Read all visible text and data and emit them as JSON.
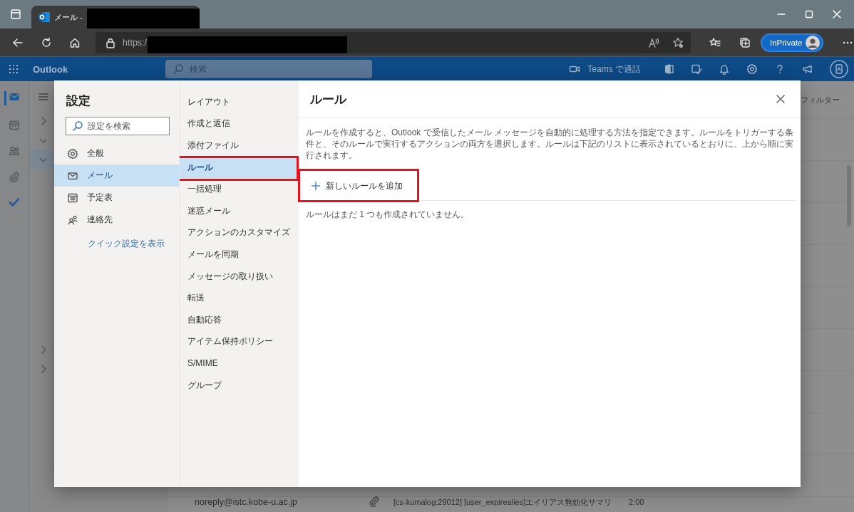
{
  "browser": {
    "tab_title": "メール -",
    "url": "https:/",
    "profile_label": "InPrivate"
  },
  "app": {
    "name": "Outlook",
    "search_placeholder": "検索",
    "teams_call": "Teams で通話"
  },
  "folders": [
    {
      "expanded": false,
      "selected": false
    },
    {
      "expanded": true,
      "selected": false
    },
    {
      "expanded": true,
      "selected": true
    }
  ],
  "folders_lower": [
    {
      "expanded": false,
      "selected": false
    },
    {
      "expanded": false,
      "selected": false
    }
  ],
  "mail_list": {
    "filter": "フィルター",
    "rows": [
      {
        "sender": "noreply@istc.kobe-u.ac.jp",
        "attachment": true,
        "subject": "[cs-kumalog:29012] [user_expirealies]エイリアス無効化サマリ",
        "time": "2:00"
      }
    ]
  },
  "settings": {
    "title": "設定",
    "search_placeholder": "設定を検索",
    "categories": [
      {
        "label": "全般",
        "selected": false
      },
      {
        "label": "メール",
        "selected": true
      },
      {
        "label": "予定表",
        "selected": false
      },
      {
        "label": "連絡先",
        "selected": false
      }
    ],
    "quick_link": "クイック設定を表示",
    "sub_items": [
      {
        "label": "レイアウト",
        "selected": false,
        "highlighted": false
      },
      {
        "label": "作成と返信",
        "selected": false,
        "highlighted": false
      },
      {
        "label": "添付ファイル",
        "selected": false,
        "highlighted": false
      },
      {
        "label": "ルール",
        "selected": true,
        "highlighted": true
      },
      {
        "label": "一括処理",
        "selected": false,
        "highlighted": false
      },
      {
        "label": "迷惑メール",
        "selected": false,
        "highlighted": false
      },
      {
        "label": "アクションのカスタマイズ",
        "selected": false,
        "highlighted": false
      },
      {
        "label": "メールを同期",
        "selected": false,
        "highlighted": false
      },
      {
        "label": "メッセージの取り扱い",
        "selected": false,
        "highlighted": false
      },
      {
        "label": "転送",
        "selected": false,
        "highlighted": false
      },
      {
        "label": "自動応答",
        "selected": false,
        "highlighted": false
      },
      {
        "label": "アイテム保持ポリシー",
        "selected": false,
        "highlighted": false
      },
      {
        "label": "S/MIME",
        "selected": false,
        "highlighted": false
      },
      {
        "label": "グループ",
        "selected": false,
        "highlighted": false
      }
    ],
    "panel": {
      "title": "ルール",
      "description": "ルールを作成すると、Outlook で受信したメール メッセージを自動的に処理する方法を指定できます。ルールをトリガーする条件と、そのルールで実行するアクションの両方を選択します。ルールは下記のリストに表示されているとおりに、上から順に実行されます。",
      "add_button": {
        "label": "新しいルールを追加",
        "highlighted": true
      },
      "empty_message": "ルールはまだ 1 つも作成されていません。"
    }
  }
}
